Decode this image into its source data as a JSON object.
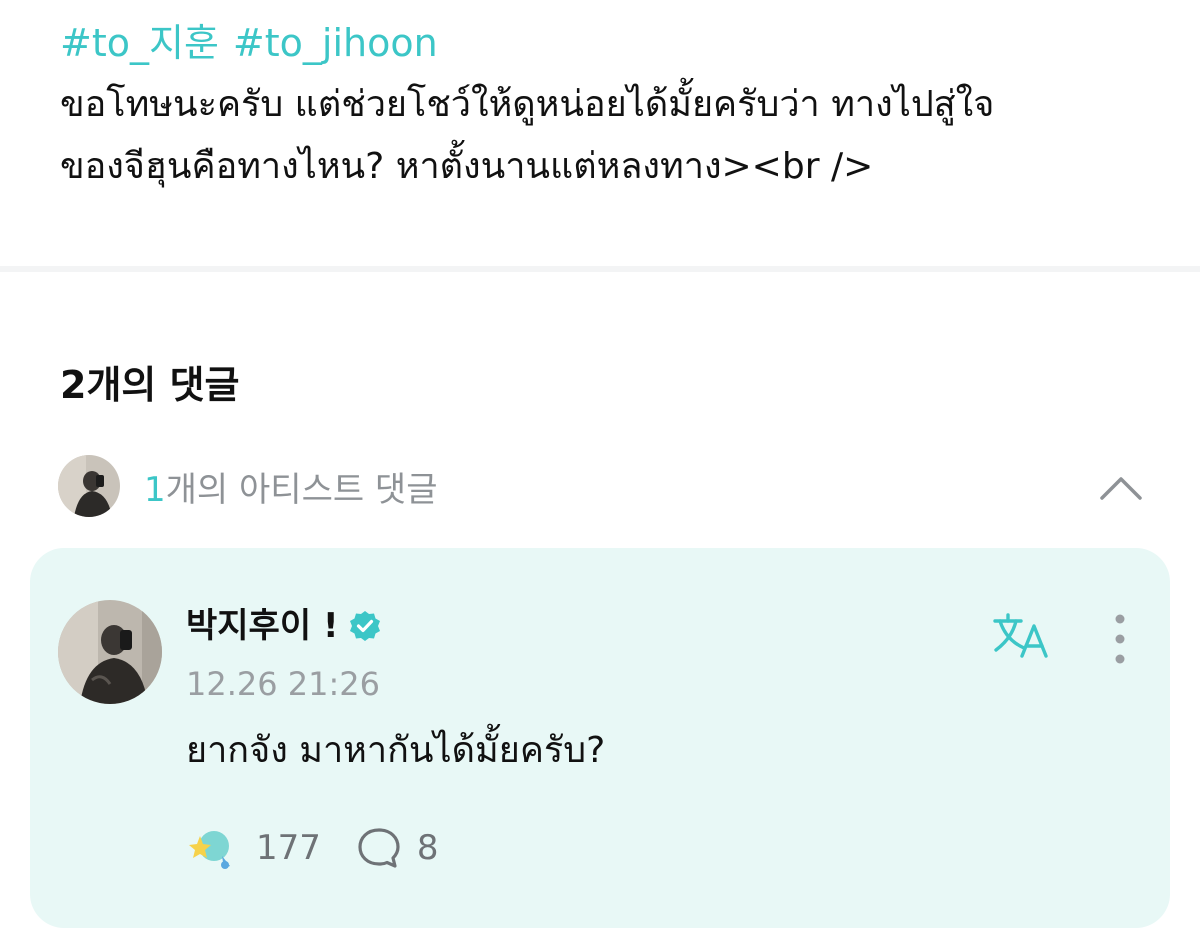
{
  "post": {
    "hashtags": [
      "#to_지훈",
      "#to_jihoon"
    ],
    "body": "ขอโทษนะครับ แต่ช่วยโชว์ให้ดูหน่อยได้มั้ยครับว่า ทางไปสู่ใจ\nของจีฮุนคือทางไหน? หาตั้งนานแต่หลงทาง><br />"
  },
  "comments_section": {
    "title": "2개의 댓글",
    "artist_comments": {
      "count": "1",
      "label": "개의 아티스트 댓글",
      "expanded": true
    }
  },
  "comment": {
    "author": "박지후이 !",
    "verified": true,
    "timestamp": "12.26 21:26",
    "text": "ยากจัง มาหากันได้มั้ยครับ?",
    "likes": "177",
    "replies": "8"
  },
  "icons": {
    "verified": "verified-badge-icon",
    "translate": "translate-icon",
    "more": "more-vertical-icon",
    "like": "sparkle-like-icon",
    "reply": "speech-bubble-icon",
    "collapse": "chevron-up-icon"
  },
  "colors": {
    "accent": "#3cc6c7",
    "card_background": "#e8f8f6",
    "secondary_text": "#8e9296"
  }
}
